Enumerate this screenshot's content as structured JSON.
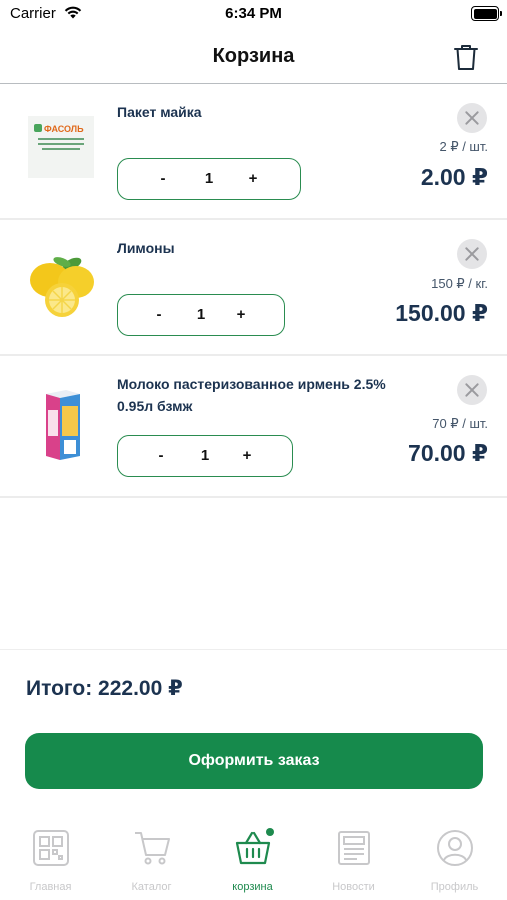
{
  "status_bar": {
    "carrier": "Carrier",
    "time": "6:34 PM"
  },
  "header": {
    "title": "Корзина",
    "trash_icon": "trash-icon"
  },
  "cart_items": [
    {
      "name": "Пакет майка",
      "unit_price": "2 ₽ / шт.",
      "total": "2.00 ₽",
      "quantity": "1",
      "minus": "-",
      "plus": "+",
      "image": "product-image-bag",
      "image_text": "ФАСОЛЬ"
    },
    {
      "name": "Лимоны",
      "unit_price": "150 ₽ / кг.",
      "total": "150.00 ₽",
      "quantity": "1",
      "minus": "-",
      "plus": "+",
      "image": "product-image-lemons"
    },
    {
      "name": "Молоко пастеризованное ирмень 2.5% 0.95л бзмж",
      "unit_price": "70 ₽ / шт.",
      "total": "70.00 ₽",
      "quantity": "1",
      "minus": "-",
      "plus": "+",
      "image": "product-image-milk"
    }
  ],
  "summary": {
    "total_text": "Итого: 222.00 ₽"
  },
  "checkout": {
    "label": "Оформить заказ"
  },
  "tabbar": {
    "tabs": [
      {
        "label": "Главная",
        "icon": "qr-code-icon",
        "active": false
      },
      {
        "label": "Каталог",
        "icon": "shopping-cart-icon",
        "active": false
      },
      {
        "label": "корзина",
        "icon": "basket-icon",
        "active": true
      },
      {
        "label": "Новости",
        "icon": "newspaper-icon",
        "active": false
      },
      {
        "label": "Профиль",
        "icon": "profile-icon",
        "active": false
      }
    ]
  },
  "colors": {
    "accent": "#168a4c",
    "text_dark": "#1c3350",
    "inactive": "#c8c8ca"
  }
}
